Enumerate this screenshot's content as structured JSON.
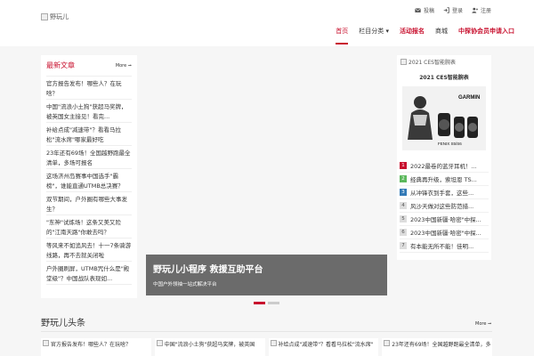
{
  "header": {
    "logo_alt": "野玩儿",
    "top_links": [
      {
        "label": "投稿",
        "icon": "envelope-icon"
      },
      {
        "label": "登录",
        "icon": "sign-in-icon"
      },
      {
        "label": "注册",
        "icon": "user-plus-icon"
      }
    ],
    "nav": [
      {
        "label": "首页",
        "state": "active"
      },
      {
        "label": "栏目分类 ▾",
        "state": "normal"
      },
      {
        "label": "活动报名",
        "state": "red"
      },
      {
        "label": "商城",
        "state": "normal"
      },
      {
        "label": "中探协会员申请入口",
        "state": "red"
      }
    ]
  },
  "latest": {
    "title": "最新文章",
    "more": "More ➞",
    "items": [
      "官方报告发布！哪些人？在玩啥？",
      "中国\"流浪小土狗\"获超马奖牌，被英国女主接见！看完...",
      "补给点成\"减速带\"？看看马拉松\"流水席\"哪家最好吃",
      "23年还有69场！全国越野跑最全清单，多场可报名",
      "这场济州岛赛事中国选手\"霸榜\"，谁能直通UTMB总决赛？",
      "双节期间，户外圈有哪些大事发生？",
      "\"东神\"试炼场！这条又美又险的\"江南天路\"你敢去吗？",
      "等风来不如追风去！十一7条骑游线路，再不去就关闭啦",
      "户外圈刷屏，UTMB咒什么是\"殿堂级\"？中国战队表现如..."
    ]
  },
  "banner": {
    "title": "野玩儿小程序 救援互助平台",
    "subtitle": "中国户外领袖一站式解决平台"
  },
  "ad": {
    "alt": "2021 CES智能腕表",
    "title": "2021 CES智能腕表",
    "brand": "GARMIN",
    "model": "FENIX S5/S6"
  },
  "ranking": [
    {
      "n": "1",
      "text": "2022最卷的蓝牙耳机！...",
      "color": "#c8102e"
    },
    {
      "n": "2",
      "text": "经典再升级，索坦恩 TS...",
      "color": "#5cb85c"
    },
    {
      "n": "3",
      "text": "从冲锋衣到手套，这些...",
      "color": "#337ab7"
    },
    {
      "n": "4",
      "text": "风沙天做对这些防范措...",
      "color": "#dddddd"
    },
    {
      "n": "5",
      "text": "2023中国新疆·哈密\"中探...",
      "color": "#dddddd"
    },
    {
      "n": "6",
      "text": "2023中国新疆·哈密\"中探...",
      "color": "#dddddd"
    },
    {
      "n": "7",
      "text": "有本能无所不能！佳明...",
      "color": "#dddddd"
    }
  ],
  "headlines": {
    "title": "野玩儿头条",
    "more": "More ➞",
    "thumbs": [
      "官方报告发布！哪些人？在玩啥？",
      "中国\"流浪小土狗\"获超马奖牌，被英国",
      "补给点成\"减速带\"？看看马拉松\"流水席\"",
      "23年还有69场！全国越野跑最全清单，多"
    ]
  },
  "colors": {
    "accent": "#c8102e",
    "banner_bg": "#6b6b6b"
  }
}
